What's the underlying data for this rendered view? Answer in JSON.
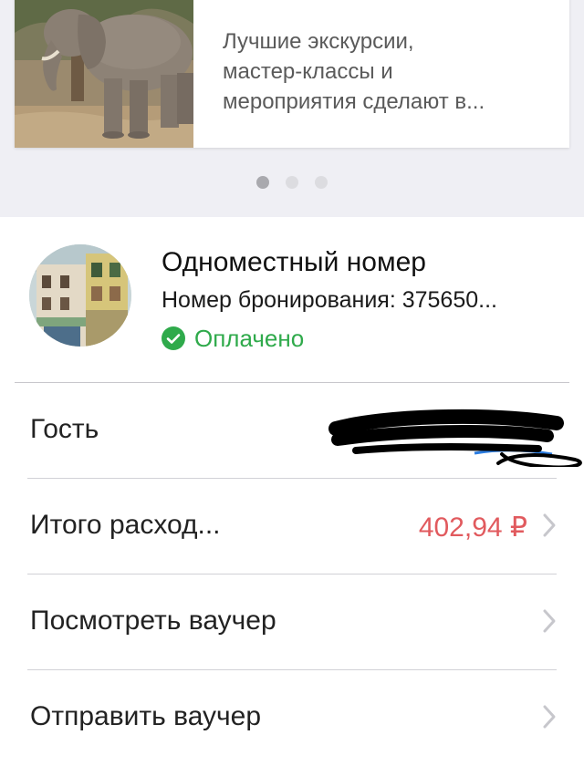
{
  "promo": {
    "description_lines": [
      "Лучшие экскурсии,",
      "мастер-классы и",
      "мероприятия сделают в..."
    ],
    "image": "elephant-photo",
    "pagination": {
      "total": 3,
      "active_index": 0
    }
  },
  "booking": {
    "room_name": "Одноместный номер",
    "booking_number": "Номер бронирования: 375650...",
    "status": "Оплачено",
    "status_icon": "check-circle-icon",
    "status_color": "#2faa4b",
    "hotel_image": "hotel-building-photo"
  },
  "rows": {
    "guest": {
      "label": "Гость",
      "value_redacted": true
    },
    "total": {
      "label": "Итого расход...",
      "value": "402,94 ₽",
      "value_color": "#e15a5e"
    },
    "view_voucher": {
      "label": "Посмотреть ваучер"
    },
    "send_voucher": {
      "label": "Отправить ваучер"
    }
  },
  "colors": {
    "accent_blue": "#2b7de1",
    "page_gray": "#efeff4",
    "chevron": "#c7c7cc"
  }
}
